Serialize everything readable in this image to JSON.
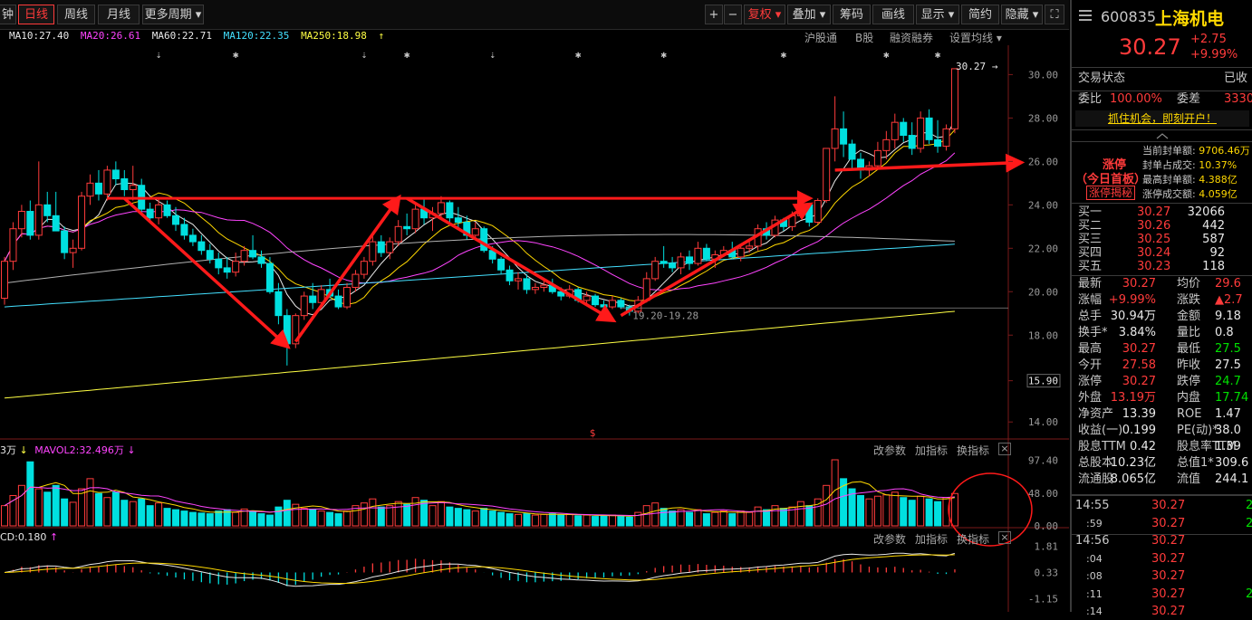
{
  "toolbar": {
    "tabs": [
      {
        "label": "钟",
        "active": false
      },
      {
        "label": "日线",
        "active": true
      },
      {
        "label": "周线",
        "active": false
      },
      {
        "label": "月线",
        "active": false
      },
      {
        "label": "更多周期 ▾",
        "active": false
      }
    ],
    "right_buttons": [
      "+",
      "−",
      "复权 ▾",
      "叠加 ▾",
      "筹码",
      "画线",
      "显示 ▾",
      "简约",
      "隐藏 ▾",
      "⛶"
    ]
  },
  "ma_legend": [
    {
      "label": "MA10:27.40",
      "color": "#e8e8e8"
    },
    {
      "label": "MA20:26.61",
      "color": "#ff44ff"
    },
    {
      "label": "MA60:22.71",
      "color": "#e8e8e8"
    },
    {
      "label": "MA120:22.35",
      "color": "#44e0ff"
    },
    {
      "label": "MA250:18.98",
      "color": "#ffff44"
    },
    {
      "label": "↑",
      "color": "#ffff44"
    }
  ],
  "sub_tools": [
    "沪股通",
    "B股",
    "融资融券",
    "设置均线 ▾"
  ],
  "vol_header": {
    "left": "3万",
    "arrow": "↓",
    "mavol": "MAVOL2:32.496万",
    "arrow2": "↓"
  },
  "macd_header": {
    "left": "CD:0.180",
    "arrow": "↑"
  },
  "panel_tools": [
    "改参数",
    "加指标",
    "换指标",
    "×"
  ],
  "chart_data": {
    "type": "candlestick",
    "price_axis": {
      "ticks": [
        "30.00",
        "28.00",
        "26.00",
        "24.00",
        "22.00",
        "20.00",
        "18.00",
        "15.90",
        "14.00"
      ],
      "ylim": [
        13.3,
        31.1
      ]
    },
    "last_price_label": "30.27",
    "range_label": "19.20-19.28",
    "volume_axis": {
      "ticks": [
        "97.40",
        "48.00",
        "0.00"
      ]
    },
    "macd_axis": {
      "ticks": [
        "1.81",
        "0.33",
        "-1.15"
      ]
    },
    "candles": [
      [
        19.7,
        21.6,
        19.4,
        21.4
      ],
      [
        21.4,
        23.2,
        21.0,
        22.9
      ],
      [
        22.9,
        24.0,
        22.5,
        23.7
      ],
      [
        23.7,
        24.2,
        22.4,
        22.6
      ],
      [
        22.6,
        26.0,
        22.4,
        24.0
      ],
      [
        24.0,
        24.6,
        23.2,
        23.5
      ],
      [
        23.5,
        24.6,
        22.8,
        22.8
      ],
      [
        22.8,
        23.0,
        21.5,
        21.8
      ],
      [
        21.8,
        22.4,
        21.1,
        22.0
      ],
      [
        22.0,
        24.6,
        21.9,
        24.4
      ],
      [
        24.4,
        25.4,
        24.0,
        25.0
      ],
      [
        25.0,
        25.6,
        24.2,
        24.5
      ],
      [
        24.5,
        25.8,
        24.2,
        25.6
      ],
      [
        25.6,
        26.0,
        24.9,
        25.2
      ],
      [
        25.2,
        25.6,
        24.4,
        24.7
      ],
      [
        24.7,
        25.8,
        24.2,
        24.9
      ],
      [
        24.9,
        25.2,
        23.6,
        23.8
      ],
      [
        23.8,
        24.1,
        23.2,
        23.4
      ],
      [
        23.4,
        24.3,
        23.1,
        24.0
      ],
      [
        24.0,
        24.2,
        23.4,
        23.5
      ],
      [
        23.5,
        23.9,
        22.8,
        23.1
      ],
      [
        23.1,
        23.4,
        22.4,
        22.6
      ],
      [
        22.6,
        22.9,
        22.1,
        22.3
      ],
      [
        22.3,
        22.6,
        21.7,
        21.9
      ],
      [
        21.9,
        22.2,
        21.3,
        21.5
      ],
      [
        21.5,
        21.8,
        20.8,
        21.1
      ],
      [
        21.1,
        21.6,
        20.6,
        20.9
      ],
      [
        20.9,
        21.8,
        20.7,
        21.4
      ],
      [
        21.4,
        22.1,
        21.2,
        21.9
      ],
      [
        21.9,
        22.6,
        21.5,
        21.6
      ],
      [
        21.6,
        21.9,
        21.1,
        21.3
      ],
      [
        21.3,
        21.6,
        19.9,
        20.0
      ],
      [
        20.0,
        20.4,
        18.5,
        18.9
      ],
      [
        18.9,
        19.2,
        16.6,
        17.6
      ],
      [
        17.6,
        19.0,
        17.4,
        18.9
      ],
      [
        18.9,
        20.0,
        18.7,
        19.8
      ],
      [
        19.8,
        20.4,
        19.2,
        19.5
      ],
      [
        19.5,
        20.3,
        19.3,
        20.1
      ],
      [
        20.1,
        20.6,
        19.7,
        19.8
      ],
      [
        19.8,
        20.1,
        19.2,
        19.3
      ],
      [
        19.3,
        20.4,
        19.2,
        20.2
      ],
      [
        20.2,
        21.0,
        20.0,
        20.8
      ],
      [
        20.8,
        21.6,
        20.6,
        21.4
      ],
      [
        21.4,
        22.6,
        21.2,
        22.3
      ],
      [
        22.3,
        22.6,
        21.6,
        21.8
      ],
      [
        21.8,
        22.5,
        21.5,
        22.3
      ],
      [
        22.3,
        23.3,
        22.1,
        23.0
      ],
      [
        23.0,
        23.6,
        22.6,
        22.9
      ],
      [
        22.9,
        24.0,
        22.7,
        23.8
      ],
      [
        23.8,
        24.3,
        23.1,
        23.4
      ],
      [
        23.4,
        23.9,
        22.8,
        23.6
      ],
      [
        23.6,
        24.4,
        23.4,
        24.1
      ],
      [
        24.1,
        24.2,
        23.2,
        23.4
      ],
      [
        23.4,
        23.9,
        22.9,
        23.2
      ],
      [
        23.2,
        23.5,
        22.4,
        22.6
      ],
      [
        22.6,
        23.2,
        22.4,
        22.9
      ],
      [
        22.9,
        23.0,
        21.8,
        21.9
      ],
      [
        21.9,
        22.1,
        21.3,
        21.5
      ],
      [
        21.5,
        21.6,
        20.8,
        21.0
      ],
      [
        21.0,
        21.2,
        20.3,
        20.5
      ],
      [
        20.5,
        20.9,
        20.1,
        20.6
      ],
      [
        20.6,
        20.8,
        19.9,
        20.1
      ],
      [
        20.1,
        20.4,
        19.9,
        20.2
      ],
      [
        20.2,
        20.5,
        20.0,
        20.3
      ],
      [
        20.3,
        20.6,
        19.9,
        20.0
      ],
      [
        20.0,
        20.2,
        19.6,
        19.8
      ],
      [
        19.8,
        20.3,
        19.7,
        20.1
      ],
      [
        20.1,
        20.2,
        19.5,
        19.6
      ],
      [
        19.6,
        20.0,
        19.4,
        19.8
      ],
      [
        19.8,
        19.9,
        19.3,
        19.4
      ],
      [
        19.4,
        19.6,
        19.1,
        19.3
      ],
      [
        19.3,
        19.8,
        19.2,
        19.6
      ],
      [
        19.6,
        19.7,
        19.2,
        19.3
      ],
      [
        19.3,
        19.4,
        18.9,
        19.1
      ],
      [
        19.1,
        19.8,
        19.0,
        19.6
      ],
      [
        19.6,
        20.9,
        19.5,
        20.6
      ],
      [
        20.6,
        21.6,
        20.5,
        21.4
      ],
      [
        21.4,
        22.1,
        21.1,
        21.3
      ],
      [
        21.3,
        21.6,
        20.9,
        21.1
      ],
      [
        21.1,
        21.8,
        20.8,
        21.6
      ],
      [
        21.6,
        21.9,
        21.0,
        21.3
      ],
      [
        21.3,
        22.3,
        21.2,
        22.0
      ],
      [
        22.0,
        22.2,
        21.4,
        21.5
      ],
      [
        21.5,
        21.9,
        21.1,
        21.7
      ],
      [
        21.7,
        22.1,
        21.6,
        21.9
      ],
      [
        21.9,
        22.3,
        21.5,
        21.6
      ],
      [
        21.6,
        22.1,
        21.4,
        22.0
      ],
      [
        22.0,
        22.4,
        21.8,
        22.1
      ],
      [
        22.1,
        23.1,
        21.9,
        22.9
      ],
      [
        22.9,
        23.2,
        22.4,
        22.6
      ],
      [
        22.6,
        23.5,
        22.5,
        23.3
      ],
      [
        23.3,
        23.4,
        22.8,
        23.0
      ],
      [
        23.0,
        23.7,
        22.8,
        23.5
      ],
      [
        23.5,
        24.2,
        23.4,
        24.0
      ],
      [
        24.0,
        24.1,
        23.0,
        23.2
      ],
      [
        23.2,
        24.3,
        23.1,
        24.2
      ],
      [
        24.2,
        26.6,
        24.1,
        26.6
      ],
      [
        26.6,
        29.0,
        26.0,
        27.5
      ],
      [
        27.5,
        28.3,
        26.2,
        26.8
      ],
      [
        26.8,
        27.0,
        25.7,
        26.1
      ],
      [
        26.1,
        26.4,
        25.2,
        25.6
      ],
      [
        25.6,
        26.0,
        25.3,
        25.8
      ],
      [
        25.8,
        26.9,
        25.7,
        26.5
      ],
      [
        26.5,
        27.4,
        26.1,
        27.0
      ],
      [
        27.0,
        28.2,
        26.6,
        27.8
      ],
      [
        27.8,
        28.0,
        26.9,
        27.2
      ],
      [
        27.2,
        27.8,
        26.3,
        26.6
      ],
      [
        26.6,
        28.3,
        26.4,
        28.0
      ],
      [
        28.0,
        28.4,
        26.8,
        27.0
      ],
      [
        27.0,
        27.9,
        26.4,
        26.7
      ],
      [
        26.7,
        27.7,
        26.5,
        27.5
      ],
      [
        27.5,
        30.27,
        27.3,
        30.27
      ]
    ],
    "volumes": [
      30,
      45,
      60,
      95,
      55,
      50,
      60,
      40,
      35,
      55,
      70,
      48,
      42,
      50,
      38,
      36,
      40,
      30,
      34,
      26,
      24,
      22,
      20,
      19,
      18,
      22,
      24,
      20,
      25,
      22,
      18,
      16,
      28,
      38,
      32,
      26,
      24,
      22,
      20,
      18,
      22,
      30,
      34,
      40,
      28,
      30,
      36,
      32,
      42,
      38,
      30,
      36,
      28,
      26,
      24,
      22,
      26,
      22,
      20,
      18,
      17,
      18,
      16,
      17,
      18,
      16,
      17,
      15,
      16,
      14,
      15,
      16,
      14,
      13,
      20,
      30,
      34,
      26,
      22,
      24,
      20,
      24,
      18,
      20,
      22,
      18,
      22,
      20,
      28,
      24,
      30,
      26,
      28,
      36,
      30,
      40,
      60,
      98,
      70,
      55,
      45,
      40,
      44,
      46,
      50,
      42,
      38,
      44,
      40,
      36,
      42,
      48
    ],
    "patterns": {
      "horizontal_arrow": {
        "from": [
          12,
          24.3
        ],
        "to": [
          94,
          24.3
        ]
      },
      "arrows": [
        {
          "from": [
            14,
            24.3
          ],
          "to": [
            33,
            17.5
          ]
        },
        {
          "from": [
            34,
            17.7
          ],
          "to": [
            46,
            24.3
          ]
        },
        {
          "from": [
            47,
            24.3
          ],
          "to": [
            71,
            18.7
          ]
        },
        {
          "from": [
            72,
            18.9
          ],
          "to": [
            94,
            24.0
          ]
        },
        {
          "from": [
            97,
            25.6
          ],
          "to": [
            109,
            25.95
          ]
        }
      ]
    }
  },
  "sidebar": {
    "code": "600835",
    "name": "上海机电",
    "price": "30.27",
    "change": "+2.75",
    "change_pct": "+9.99%",
    "status_label": "交易状态",
    "status_value": "已收",
    "webi_label": "委比",
    "webi_value": "100.00%",
    "weicha_label": "委差",
    "weicha_value": "3330",
    "promo": "抓住机会，即刻开户！",
    "limit_tag": "涨停",
    "first_board": "（今日首板）",
    "limit_link": "涨停揭秘",
    "seal_info": [
      {
        "label": "当前封单额:",
        "value": "9706.46万"
      },
      {
        "label": "封单占成交:",
        "value": "10.37%"
      },
      {
        "label": "最高封单额:",
        "value": "4.388亿"
      },
      {
        "label": "涨停成交额:",
        "value": "4.059亿"
      }
    ],
    "bids": [
      {
        "label": "买一",
        "price": "30.27",
        "vol": "32066"
      },
      {
        "label": "买二",
        "price": "30.26",
        "vol": "442"
      },
      {
        "label": "买三",
        "price": "30.25",
        "vol": "587"
      },
      {
        "label": "买四",
        "price": "30.24",
        "vol": "92"
      },
      {
        "label": "买五",
        "price": "30.23",
        "vol": "118"
      }
    ],
    "stats": [
      {
        "l1": "最新",
        "v1": "30.27",
        "c1": "red",
        "l2": "均价",
        "v2": "29.6",
        "c2": "red"
      },
      {
        "l1": "涨幅",
        "v1": "+9.99%",
        "c1": "red",
        "l2": "涨跌",
        "v2": "▲2.7",
        "c2": "red"
      },
      {
        "l1": "总手",
        "v1": "30.94万",
        "c1": "white",
        "l2": "金额",
        "v2": "9.18",
        "c2": "white"
      },
      {
        "l1": "换手*",
        "v1": "3.84%",
        "c1": "white",
        "l2": "量比",
        "v2": "0.8",
        "c2": "white"
      },
      {
        "l1": "最高",
        "v1": "30.27",
        "c1": "red",
        "l2": "最低",
        "v2": "27.5",
        "c2": "green"
      },
      {
        "l1": "今开",
        "v1": "27.58",
        "c1": "red",
        "l2": "昨收",
        "v2": "27.5",
        "c2": "white"
      },
      {
        "l1": "涨停",
        "v1": "30.27",
        "c1": "red",
        "l2": "跌停",
        "v2": "24.7",
        "c2": "green"
      },
      {
        "l1": "外盘",
        "v1": "13.19万",
        "c1": "red",
        "l2": "内盘",
        "v2": "17.74",
        "c2": "green"
      },
      {
        "l1": "净资产",
        "v1": "13.39",
        "c1": "white",
        "l2": "ROE",
        "v2": "1.47",
        "c2": "white"
      },
      {
        "l1": "收益(一)",
        "v1": "0.199",
        "c1": "white",
        "l2": "PE(动)*",
        "v2": "38.0",
        "c2": "white"
      },
      {
        "l1": "股息TTM",
        "v1": "0.42",
        "c1": "white",
        "l2": "股息率TTM",
        "v2": "1.39",
        "c2": "white"
      },
      {
        "l1": "总股本",
        "v1": "10.23亿",
        "c1": "white",
        "l2": "总值1*",
        "v2": "309.6",
        "c2": "white"
      },
      {
        "l1": "流通股",
        "v1": "8.065亿",
        "c1": "white",
        "l2": "流值",
        "v2": "244.1",
        "c2": "white"
      }
    ],
    "ticks": [
      {
        "time": "14:55",
        "price": "30.27",
        "vol": "2"
      },
      {
        "time": ":59",
        "price": "30.27",
        "vol": "2"
      },
      {
        "time": "14:56",
        "price": "30.27",
        "vol": ""
      },
      {
        "time": ":04",
        "price": "30.27",
        "vol": ""
      },
      {
        "time": ":08",
        "price": "30.27",
        "vol": ""
      },
      {
        "time": ":11",
        "price": "30.27",
        "vol": "2"
      },
      {
        "time": ":14",
        "price": "30.27",
        "vol": ""
      }
    ]
  }
}
